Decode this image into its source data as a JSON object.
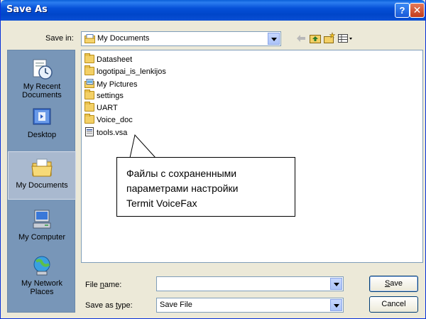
{
  "window": {
    "title": "Save As"
  },
  "titlebar": {
    "help_glyph": "?",
    "close_glyph": "✕"
  },
  "savein": {
    "label": "Save in:",
    "value": "My Documents"
  },
  "places": [
    {
      "label": "My Recent\nDocuments",
      "icon": "recent-documents-icon"
    },
    {
      "label": "Desktop",
      "icon": "desktop-icon"
    },
    {
      "label": "My Documents",
      "icon": "my-documents-icon"
    },
    {
      "label": "My Computer",
      "icon": "my-computer-icon"
    },
    {
      "label": "My Network\nPlaces",
      "icon": "network-places-icon"
    }
  ],
  "files": [
    {
      "name": "Datasheet",
      "type": "folder"
    },
    {
      "name": "logotipai_is_lenkijos",
      "type": "folder"
    },
    {
      "name": "My Pictures",
      "type": "pictures-folder"
    },
    {
      "name": "settings",
      "type": "folder"
    },
    {
      "name": "UART",
      "type": "folder"
    },
    {
      "name": "Voice_doc",
      "type": "folder"
    },
    {
      "name": "tools.vsa",
      "type": "file"
    }
  ],
  "callout": {
    "lines": [
      "Файлы с сохраненными",
      "параметрами настройки",
      "Termit VoiceFax"
    ]
  },
  "filename": {
    "label_pre": "File ",
    "label_ul": "n",
    "label_post": "ame:",
    "value": ""
  },
  "filetype": {
    "label_pre": "Save as ",
    "label_ul": "t",
    "label_post": "ype:",
    "value": "Save File"
  },
  "buttons": {
    "save_ul": "S",
    "save_rest": "ave",
    "cancel": "Cancel"
  },
  "colors": {
    "titlebar": "#0055e5",
    "places_bar": "#7896b8",
    "dialog_bg": "#ece9d8"
  }
}
